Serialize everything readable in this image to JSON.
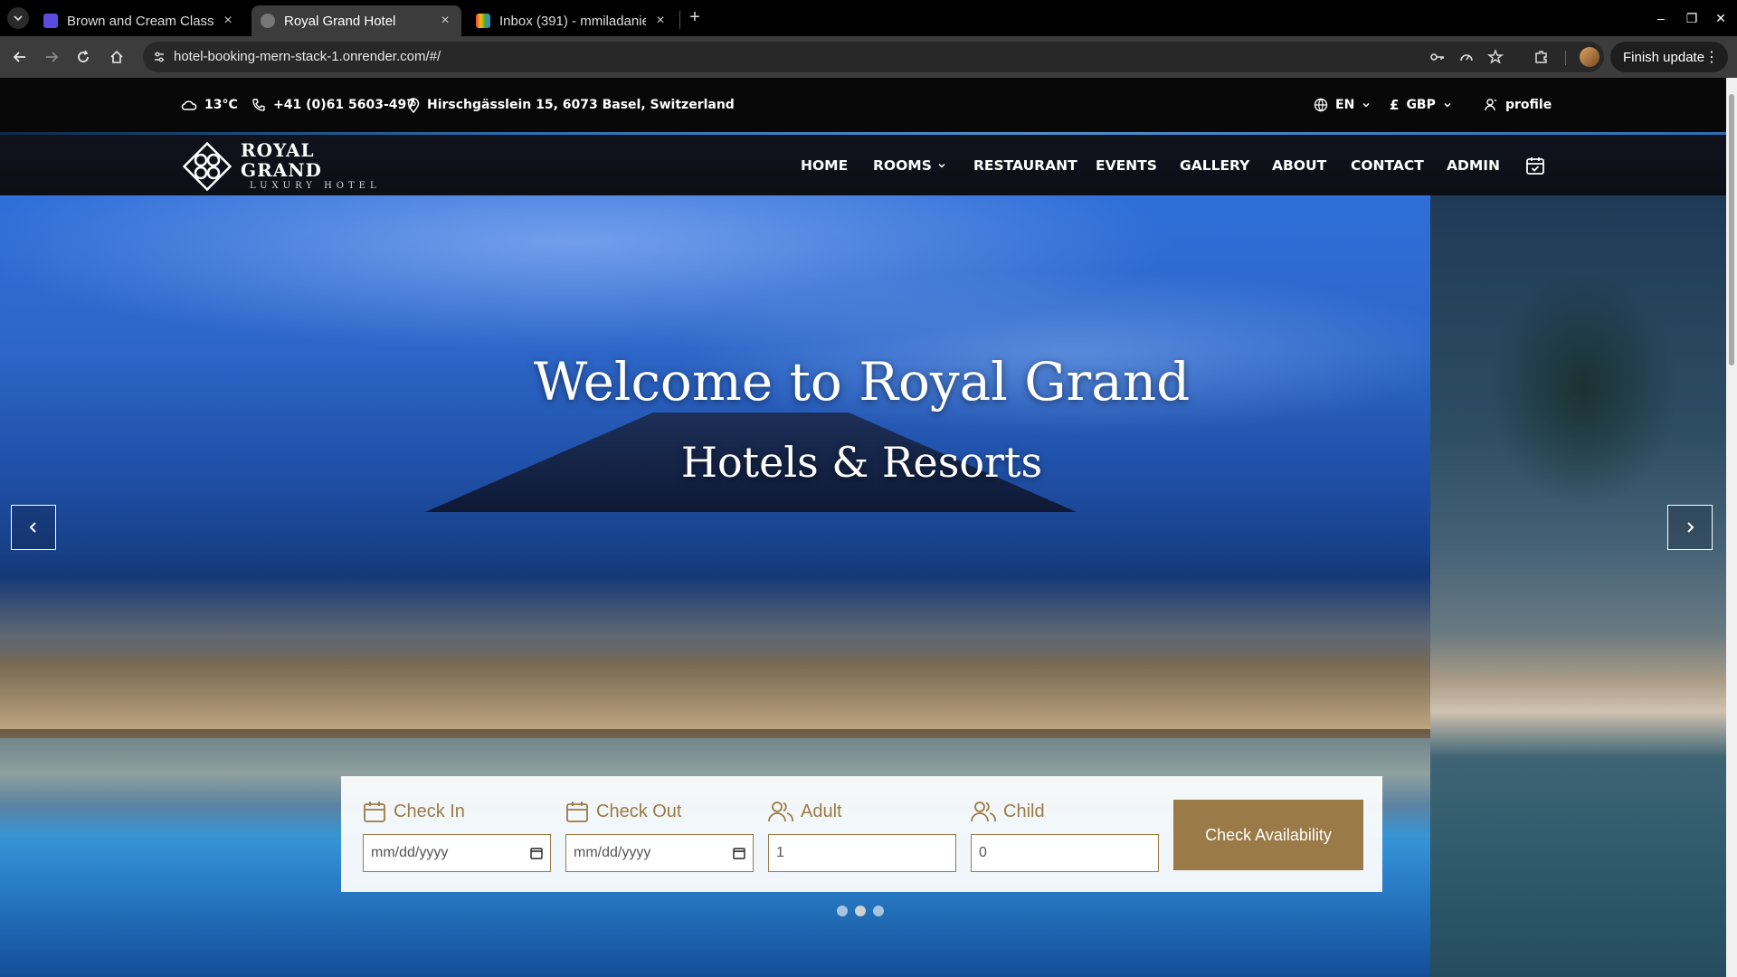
{
  "browser": {
    "tabs": [
      {
        "title": "Brown and Cream Classy",
        "active": false
      },
      {
        "title": "Royal Grand Hotel",
        "active": true
      },
      {
        "title": "Inbox (391) - mmiladanie",
        "active": false
      }
    ],
    "url": "hotel-booking-mern-stack-1.onrender.com/#/",
    "finish_update_label": "Finish update"
  },
  "topbar": {
    "weather": "13°C",
    "phone": "+41 (0)61 5603-497",
    "address": "Hirschgässlein 15, 6073 Basel, Switzerland",
    "language": "EN",
    "currency": "GBP",
    "profile": "profile"
  },
  "logo": {
    "name": "ROYAL GRAND",
    "sub": "LUXURY HOTEL"
  },
  "nav": {
    "items": [
      "HOME",
      "ROOMS",
      "RESTAURANT",
      "EVENTS",
      "GALLERY",
      "ABOUT",
      "CONTACT",
      "ADMIN"
    ]
  },
  "hero": {
    "title": "Welcome to Royal Grand",
    "subtitle": "Hotels & Resorts"
  },
  "booking": {
    "check_in_label": "Check In",
    "check_in_placeholder": "mm/dd/yyyy",
    "check_out_label": "Check Out",
    "check_out_placeholder": "mm/dd/yyyy",
    "adult_label": "Adult",
    "adult_value": "1",
    "child_label": "Child",
    "child_value": "0",
    "submit_label": "Check Availability"
  },
  "carousel": {
    "slides": 3,
    "active": 2
  },
  "colors": {
    "accent": "#9a7a46",
    "nav_bg": "#10131c",
    "topbar_bg": "#080808"
  }
}
